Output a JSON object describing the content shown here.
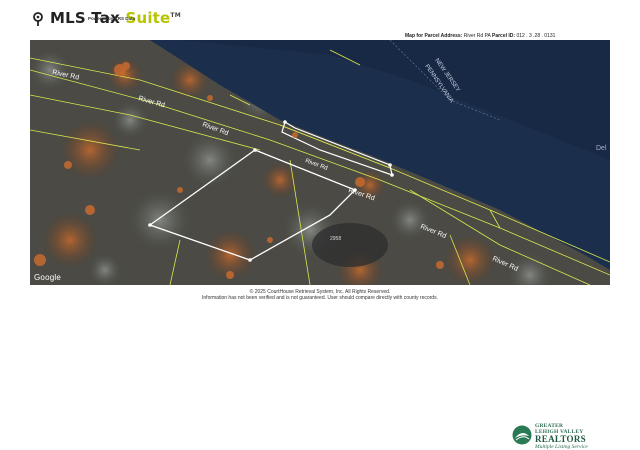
{
  "header": {
    "logo_main": "MLS Tax ",
    "logo_accent": "Suite",
    "logo_tm": "TM",
    "logo_powered": "Powered by CRS Data"
  },
  "map_caption": {
    "prefix": "Map for Parcel Address:",
    "address": "River Rd PA",
    "parcel_label": "Parcel ID:",
    "parcel_id": "012 . 3 .28 . 0131"
  },
  "map": {
    "labels": {
      "river_rd_1": "River Rd",
      "river_rd_2": "River Rd",
      "river_rd_3": "River Rd",
      "river_rd_4": "River Rd",
      "river_rd_5": "River Rd",
      "river_rd_6": "River Rd",
      "river_rd_7": "River Rd",
      "state_nj": "NEW JERSEY",
      "state_pa": "PENNSYLVANIA",
      "river_name": "Del",
      "parcel_number": "2958"
    },
    "google": "Google",
    "colors": {
      "river": "#1b2f4d",
      "parcel_line": "#d9e84f",
      "subject_outline": "#ffffff",
      "foliage": "#a8562a"
    }
  },
  "footer": {
    "line1": "© 2025 CourtHouse Retrieval System, Inc. All Rights Reserved.",
    "line2": "Information has not been verified and is not guaranteed. User should compare directly with county records."
  },
  "branding": {
    "line1": "GREATER",
    "line2": "LEHIGH VALLEY",
    "line3": "REALTORS",
    "line4": "Multiple Listing Service"
  }
}
